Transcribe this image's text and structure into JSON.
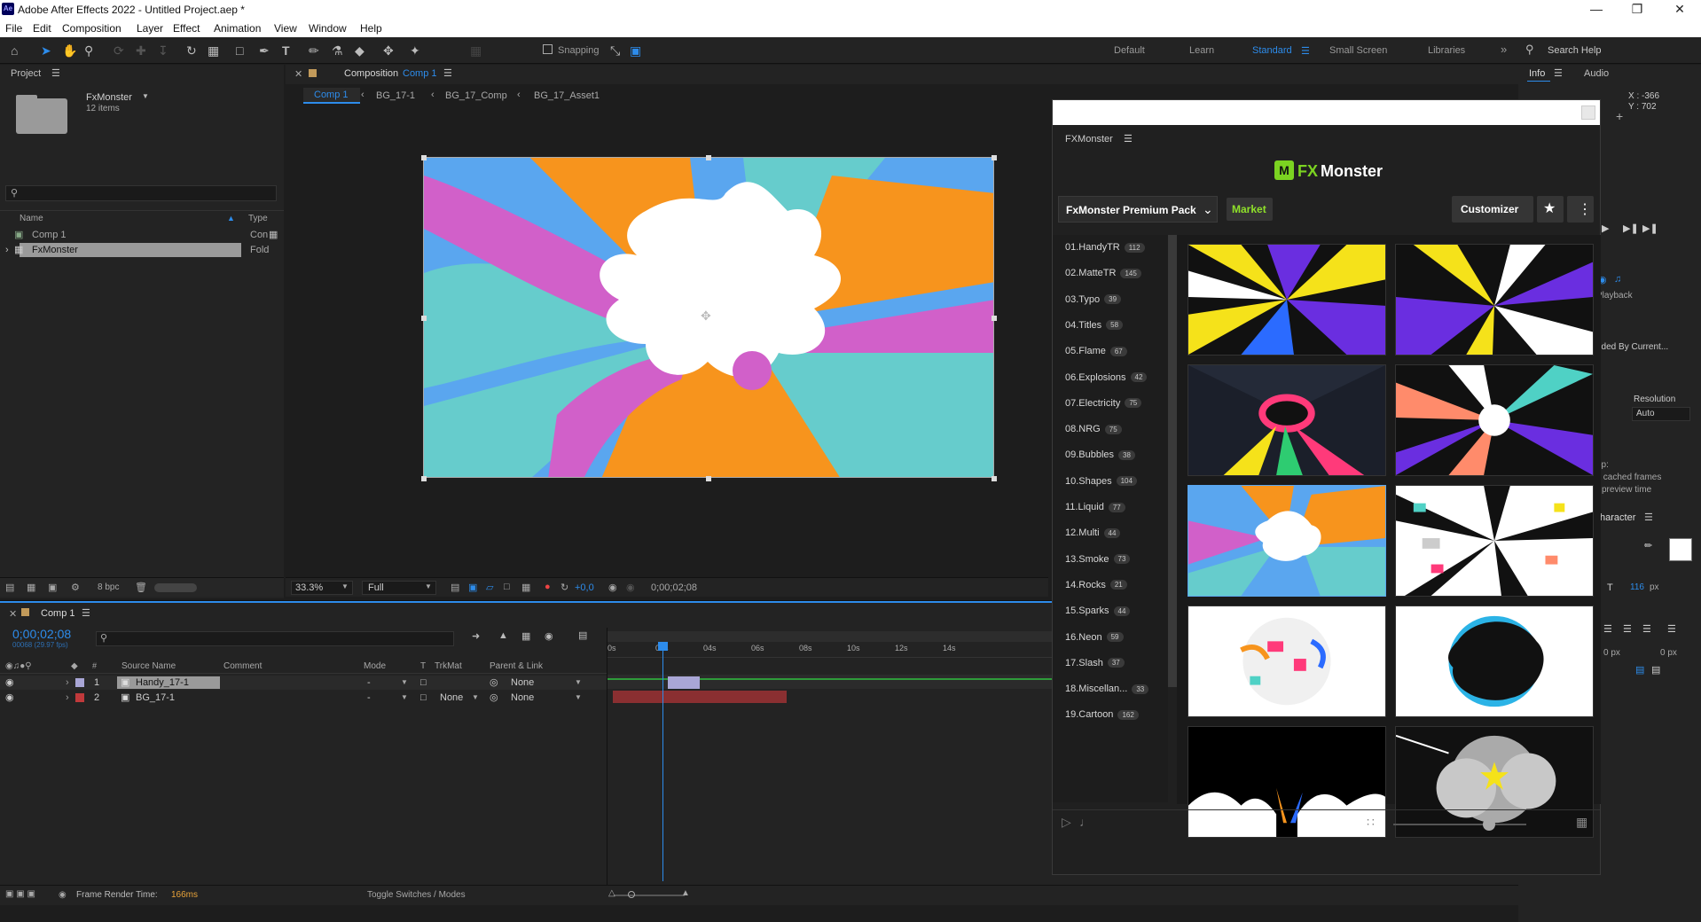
{
  "title_bar": {
    "app_logo": "Ae",
    "title": "Adobe After Effects 2022 - Untitled Project.aep *"
  },
  "menu": [
    "File",
    "Edit",
    "Composition",
    "Layer",
    "Effect",
    "Animation",
    "View",
    "Window",
    "Help"
  ],
  "toolbar": {
    "snapping_label": "Snapping",
    "workspaces": [
      "Default",
      "Learn",
      "Standard",
      "Small Screen",
      "Libraries"
    ],
    "active_workspace": "Standard",
    "search_placeholder": "Search Help"
  },
  "project_panel": {
    "tab": "Project",
    "folder_name": "FxMonster",
    "folder_count": "12 items",
    "columns": {
      "name": "Name",
      "type": "Type"
    },
    "items": [
      {
        "name": "Comp 1",
        "type": "Con"
      },
      {
        "name": "FxMonster",
        "type": "Fold"
      }
    ],
    "bpc": "8 bpc"
  },
  "composition_panel": {
    "tab_prefix": "Composition",
    "tab_name": "Comp 1",
    "breadcrumbs": [
      "Comp 1",
      "BG_17-1",
      "BG_17_Comp",
      "BG_17_Asset1"
    ],
    "zoom": "33.3%",
    "resolution": "Full",
    "exposure": "+0,0",
    "timecode": "0;00;02;08"
  },
  "timeline": {
    "tab": "Comp 1",
    "timecode": "0;00;02;08",
    "fps": "00068 (29.97 fps)",
    "columns": {
      "source": "Source Name",
      "comment": "Comment",
      "mode": "Mode",
      "t": "T",
      "trkmat": "TrkMat",
      "parent": "Parent & Link"
    },
    "ruler": [
      "0s",
      "02s",
      "04s",
      "06s",
      "08s",
      "10s",
      "12s",
      "14s"
    ],
    "layers": [
      {
        "num": "1",
        "name": "Handy_17-1",
        "mode": "-",
        "trkmat": "",
        "parent": "None",
        "label_color": "#a9a6d6"
      },
      {
        "num": "2",
        "name": "BG_17-1",
        "mode": "-",
        "trkmat": "None",
        "parent": "None",
        "label_color": "#c0393b"
      }
    ],
    "playhead": 0.155
  },
  "status_bar": {
    "render_label": "Frame Render Time:",
    "render_value": "166ms",
    "toggle": "Toggle Switches / Modes"
  },
  "info_panel": {
    "tabs": [
      "Info",
      "Audio"
    ],
    "x": "X : -366",
    "y": "Y : 702"
  },
  "right_panel": {
    "playback": "Playback",
    "ended_by": "nded By Current...",
    "resolution_label": "Resolution",
    "resolution_value": "Auto",
    "cached": "y cached frames",
    "preview_time": "preview time",
    "character_tab": "haracter",
    "font_size": "116",
    "font_unit": "px",
    "px0": "0 px",
    "px1": "0 px",
    "op": "op:"
  },
  "fxmonster": {
    "panel_title": "FXMonster",
    "logo_prefix": "FX",
    "logo_suffix": "Monster",
    "pack": "FxMonster Premium Pack",
    "market": "Market",
    "customizer": "Customizer",
    "categories": [
      {
        "name": "01.HandyTR",
        "count": "112"
      },
      {
        "name": "02.MatteTR",
        "count": "145"
      },
      {
        "name": "03.Typo",
        "count": "39"
      },
      {
        "name": "04.Titles",
        "count": "58"
      },
      {
        "name": "05.Flame",
        "count": "67"
      },
      {
        "name": "06.Explosions",
        "count": "42"
      },
      {
        "name": "07.Electricity",
        "count": "75"
      },
      {
        "name": "08.NRG",
        "count": "75"
      },
      {
        "name": "09.Bubbles",
        "count": "38"
      },
      {
        "name": "10.Shapes",
        "count": "104"
      },
      {
        "name": "11.Liquid",
        "count": "77"
      },
      {
        "name": "12.Multi",
        "count": "44"
      },
      {
        "name": "13.Smoke",
        "count": "73"
      },
      {
        "name": "14.Rocks",
        "count": "21"
      },
      {
        "name": "15.Sparks",
        "count": "44"
      },
      {
        "name": "16.Neon",
        "count": "59"
      },
      {
        "name": "17.Slash",
        "count": "37"
      },
      {
        "name": "18.Miscellan...",
        "count": "33"
      },
      {
        "name": "19.Cartoon",
        "count": "162"
      }
    ],
    "thumb_size": 0.72
  },
  "colors": {
    "accent": "#2d8ceb",
    "market_green": "#8fe02a",
    "brand_green": "#7bd321"
  }
}
